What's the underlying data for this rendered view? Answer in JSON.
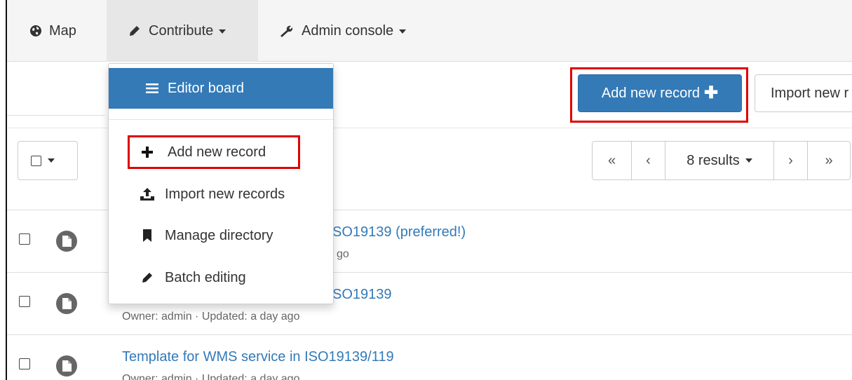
{
  "navbar": {
    "map_label": "Map",
    "contribute_label": "Contribute",
    "admin_label": "Admin console"
  },
  "contribute_menu": {
    "editor_board": "Editor board",
    "add_new_record": "Add new record",
    "import_new_records": "Import new records",
    "manage_directory": "Manage directory",
    "batch_editing": "Batch editing"
  },
  "toolbar": {
    "add_button_label": "Add new record",
    "import_button_label": "Import new r"
  },
  "pagination": {
    "first": "«",
    "prev": "‹",
    "results_label": "8 results",
    "next": "›",
    "last": "»"
  },
  "records": [
    {
      "title": "SO19139 (preferred!)",
      "meta": "go"
    },
    {
      "title": "SO19139",
      "meta": "Owner: admin · Updated: a day ago"
    },
    {
      "title": "Template for WMS service in ISO19139/119",
      "meta": "Owner: admin · Updated: a day ago"
    }
  ],
  "icons": {
    "map": "globe-icon",
    "contribute": "pencil-icon",
    "admin": "wrench-icon",
    "editor_board": "menu-bars-icon",
    "add": "plus-icon",
    "import": "upload-icon",
    "manage": "bookmark-icon",
    "batch": "pencil-icon",
    "record": "document-icon"
  },
  "colors": {
    "primary": "#337ab7",
    "highlight": "#e00000",
    "link": "#337ab7",
    "navbar_bg": "#f5f5f5",
    "active_nav_bg": "#e7e7e7"
  }
}
